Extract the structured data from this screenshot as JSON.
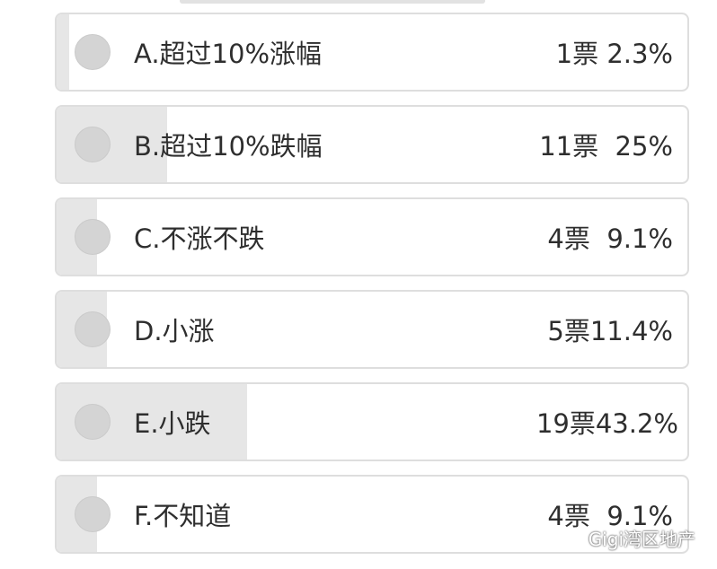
{
  "poll": {
    "options": [
      {
        "label": "A.超过10%涨幅",
        "votes": "1票",
        "percent": "2.3%",
        "share": 0.023
      },
      {
        "label": "B.超过10%跌幅",
        "votes": "11票",
        "percent": "25%",
        "share": 0.25
      },
      {
        "label": "C.不涨不跌",
        "votes": "4票",
        "percent": "9.1%",
        "share": 0.091
      },
      {
        "label": "D.小涨",
        "votes": "5票",
        "percent": "11.4%",
        "share": 0.114
      },
      {
        "label": "E.小跌",
        "votes": "19票",
        "percent": "43.2%",
        "share": 0.432
      },
      {
        "label": "F.不知道",
        "votes": "4票",
        "percent": "9.1%",
        "share": 0.091
      }
    ]
  },
  "watermark": {
    "icon": "wechat-icon",
    "text": "Gigi湾区地产"
  },
  "colors": {
    "bar_fill": "#e6e6e6",
    "border": "#dedede",
    "radio": "#d4d4d4",
    "text": "#2e2e2e"
  }
}
